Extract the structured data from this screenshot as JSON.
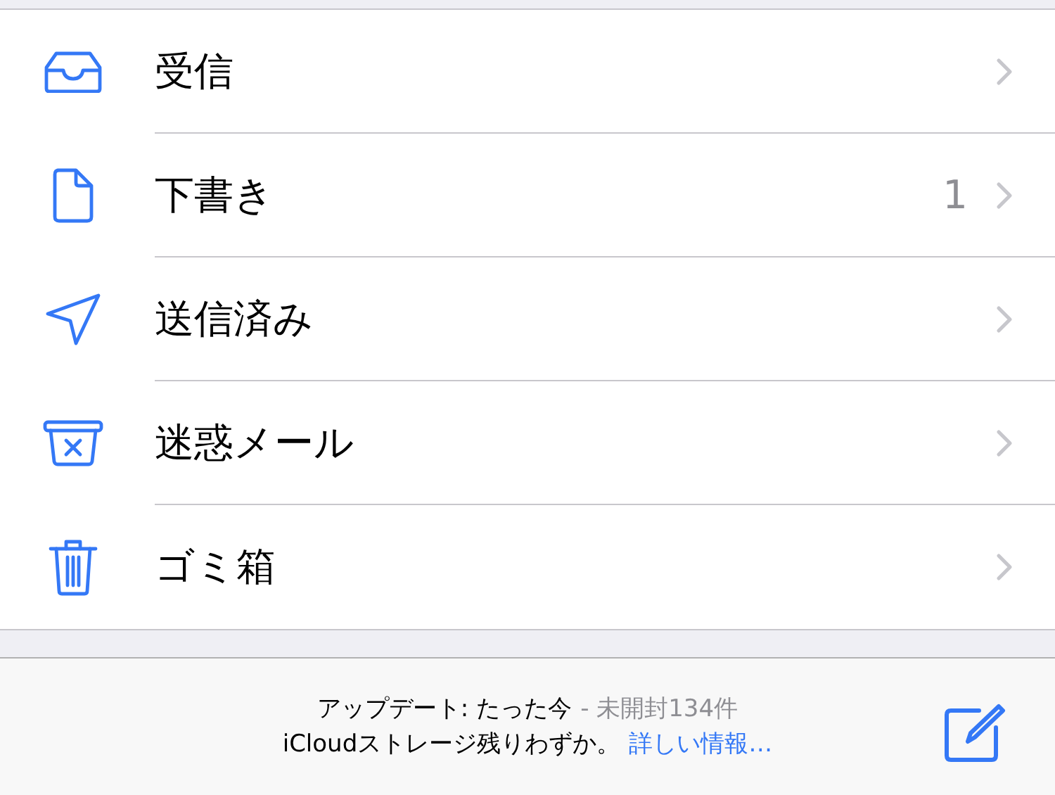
{
  "folders": [
    {
      "kind": "inbox",
      "label": "受信"
    },
    {
      "kind": "drafts",
      "label": "下書き",
      "count": "1"
    },
    {
      "kind": "sent",
      "label": "送信済み"
    },
    {
      "kind": "junk",
      "label": "迷惑メール"
    },
    {
      "kind": "trash",
      "label": "ゴミ箱"
    }
  ],
  "status_bar": {
    "updated": "アップデート: たった今",
    "unread": "- 未開封134件",
    "storage_notice": "iCloudストレージ残りわずか。",
    "link": "詳しい情報…"
  }
}
